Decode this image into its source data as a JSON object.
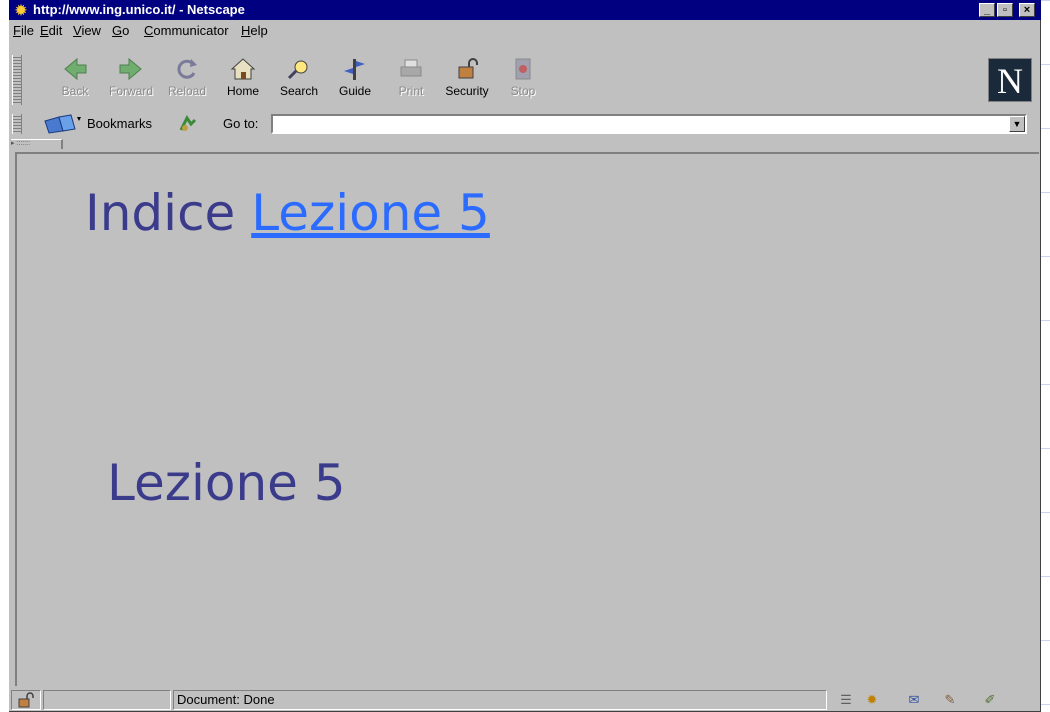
{
  "window": {
    "title": "http://www.ing.unico.it/ - Netscape",
    "buttons": {
      "minimize": "_",
      "maximize": "▫",
      "close": "×"
    }
  },
  "menubar": {
    "items": [
      {
        "key": "F",
        "rest": "ile"
      },
      {
        "key": "E",
        "rest": "dit"
      },
      {
        "key": "V",
        "rest": "iew"
      },
      {
        "key": "G",
        "rest": "o"
      },
      {
        "key": "C",
        "rest": "ommunicator"
      },
      {
        "key": "H",
        "rest": "elp"
      }
    ]
  },
  "toolbar": {
    "buttons": [
      {
        "label": "Back",
        "icon": "back-arrow-icon",
        "enabled": false
      },
      {
        "label": "Forward",
        "icon": "forward-arrow-icon",
        "enabled": false
      },
      {
        "label": "Reload",
        "icon": "reload-icon",
        "enabled": false
      },
      {
        "label": "Home",
        "icon": "home-icon",
        "enabled": true
      },
      {
        "label": "Search",
        "icon": "search-icon",
        "enabled": true
      },
      {
        "label": "Guide",
        "icon": "guide-icon",
        "enabled": true
      },
      {
        "label": "Print",
        "icon": "print-icon",
        "enabled": false
      },
      {
        "label": "Security",
        "icon": "lock-icon",
        "enabled": true
      },
      {
        "label": "Stop",
        "icon": "stop-icon",
        "enabled": false
      }
    ],
    "logo": "N"
  },
  "location": {
    "bookmarks_label": "Bookmarks",
    "goto_label": "Go to:",
    "url_value": ""
  },
  "content": {
    "heading_prefix": "Indice",
    "heading_link": "Lezione 5",
    "subheading": "Lezione 5"
  },
  "status": {
    "text": "Document: Done"
  },
  "colors": {
    "titlebar": "#000080",
    "chrome": "#c0c0c0",
    "heading_text": "#3b3b8c",
    "link": "#2b6bff"
  }
}
